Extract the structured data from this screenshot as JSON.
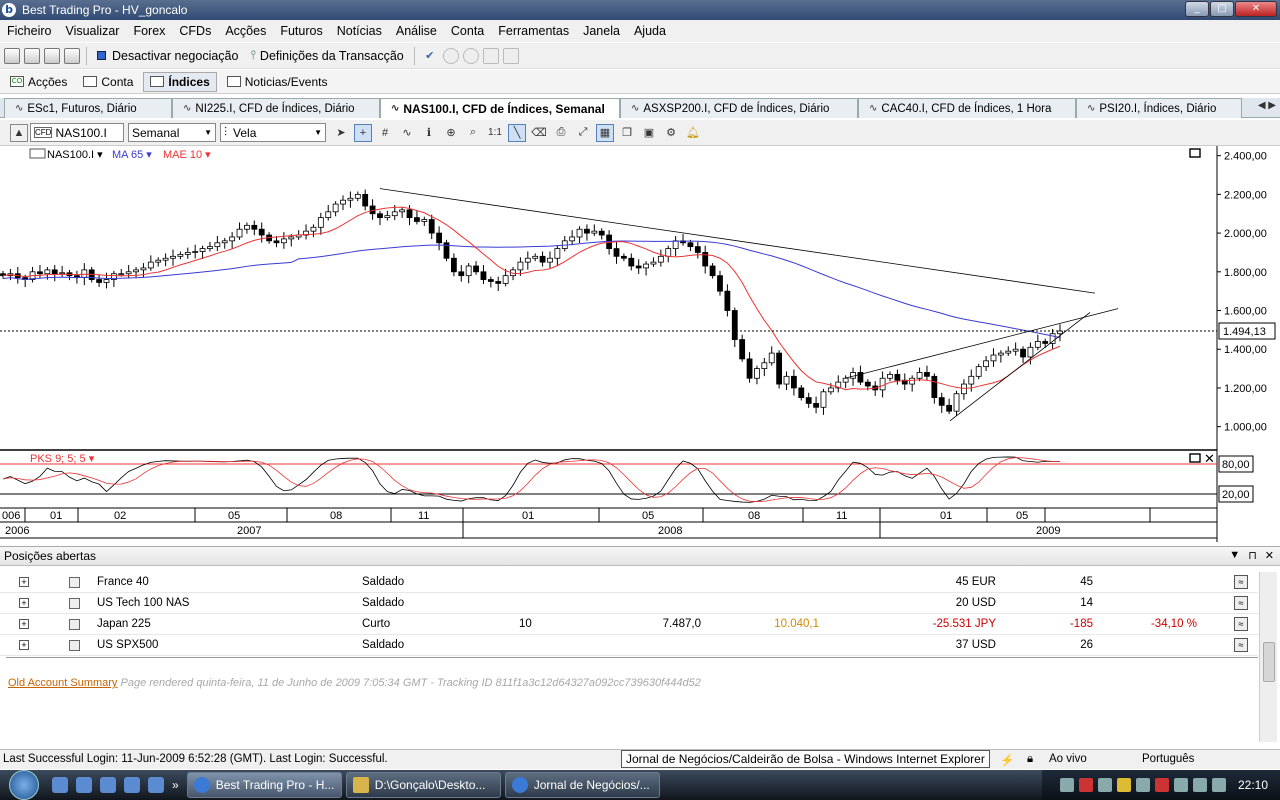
{
  "window": {
    "title": "Best Trading Pro - HV_goncalo"
  },
  "menu": [
    "Ficheiro",
    "Visualizar",
    "Forex",
    "CFDs",
    "Acções",
    "Futuros",
    "Notícias",
    "Análise",
    "Conta",
    "Ferramentas",
    "Janela",
    "Ajuda"
  ],
  "toolbar": {
    "deactivate": "Desactivar negociação",
    "settings": "Definições da Transacção"
  },
  "views": [
    {
      "label": "Acções",
      "active": false
    },
    {
      "label": "Conta",
      "active": false
    },
    {
      "label": "Índices",
      "active": true
    },
    {
      "label": "Noticias/Events",
      "active": false
    }
  ],
  "tabs": [
    "ESc1, Futuros, Diário",
    "NI225.I, CFD de Índices, Diário",
    "NAS100.I, CFD de Índices, Semanal",
    "ASXSP200.I, CFD de Índices, Diário",
    "CAC40.I, CFD de Índices, 1 Hora",
    "PSI20.I, Índices, Diário"
  ],
  "active_tab": 2,
  "chart_toolbar": {
    "symbol": "NAS100.I",
    "period": "Semanal",
    "style": "Vela",
    "zoom": "1:1"
  },
  "legend": {
    "symbol": "NAS100.I",
    "ma": "MA 65",
    "mae": "MAE 10",
    "pks": "PKS 9; 5; 5",
    "cfd_badge": "CFD"
  },
  "chart_data": {
    "type": "candlestick",
    "price_axis_ticks": [
      "2.400,00",
      "2.200,00",
      "2.000,00",
      "1.800,00",
      "1.600,00",
      "1.400,00",
      "1.200,00",
      "1.000,00"
    ],
    "ylim": [
      900,
      2450
    ],
    "current_price": "1.494,13",
    "stoch_ticks": [
      "80,00",
      "20,00"
    ],
    "month_labels": [
      "006",
      "01",
      "02",
      "05",
      "08",
      "11",
      "01",
      "05",
      "08",
      "11",
      "01",
      "05"
    ],
    "year_labels": [
      "2006",
      "2007",
      "2008",
      "2009"
    ],
    "series": [
      {
        "name": "NAS100.I",
        "close": [
          1780,
          1790,
          1770,
          1760,
          1800,
          1790,
          1810,
          1790,
          1795,
          1780,
          1770,
          1810,
          1760,
          1745,
          1760,
          1790,
          1790,
          1800,
          1810,
          1820,
          1850,
          1860,
          1870,
          1880,
          1890,
          1900,
          1905,
          1920,
          1930,
          1950,
          1960,
          1980,
          2020,
          2040,
          2020,
          1990,
          1960,
          1950,
          1970,
          1980,
          1990,
          2010,
          2030,
          2080,
          2110,
          2150,
          2170,
          2180,
          2200,
          2140,
          2100,
          2080,
          2090,
          2110,
          2120,
          2080,
          2060,
          2070,
          2000,
          1950,
          1870,
          1800,
          1780,
          1830,
          1800,
          1760,
          1750,
          1740,
          1780,
          1810,
          1850,
          1870,
          1880,
          1850,
          1870,
          1920,
          1960,
          1980,
          2020,
          2000,
          2010,
          1990,
          1920,
          1880,
          1870,
          1830,
          1820,
          1840,
          1850,
          1880,
          1920,
          1960,
          1950,
          1930,
          1900,
          1830,
          1780,
          1700,
          1600,
          1450,
          1350,
          1250,
          1300,
          1330,
          1380,
          1220,
          1260,
          1200,
          1150,
          1120,
          1100,
          1180,
          1200,
          1230,
          1250,
          1280,
          1230,
          1210,
          1190,
          1250,
          1270,
          1240,
          1220,
          1250,
          1280,
          1260,
          1150,
          1110,
          1080,
          1170,
          1220,
          1260,
          1310,
          1340,
          1370,
          1380,
          1390,
          1400,
          1360,
          1410,
          1440,
          1430,
          1480,
          1494
        ]
      },
      {
        "name": "MA 65"
      },
      {
        "name": "MAE 10"
      }
    ]
  },
  "positions": {
    "title": "Posições abertas",
    "rows": [
      {
        "name": "France 40",
        "status": "Saldado",
        "qty": "",
        "open": "",
        "current": "",
        "pl": "45 EUR",
        "pips": "45",
        "pct": ""
      },
      {
        "name": "US Tech 100 NAS",
        "status": "Saldado",
        "qty": "",
        "open": "",
        "current": "",
        "pl": "20 USD",
        "pips": "14",
        "pct": ""
      },
      {
        "name": "Japan 225",
        "status": "Curto",
        "qty": "10",
        "open": "7.487,0",
        "current": "10.040,1",
        "pl": "-25.531 JPY",
        "pips": "-185",
        "pct": "-34,10 %"
      },
      {
        "name": "US SPX500",
        "status": "Saldado",
        "qty": "",
        "open": "",
        "current": "",
        "pl": "37 USD",
        "pips": "26",
        "pct": ""
      }
    ]
  },
  "footer": {
    "link": "Old Account Summary",
    "text": "Page rendered quinta-feira, 11 de Junho de 2009 7:05:34 GMT - Tracking ID 811f1a3c12d64327a092cc739630f444d52"
  },
  "status": {
    "login": "Last Successful Login: 11-Jun-2009 6:52:28 (GMT). Last Login: Successful.",
    "mode": "Ao vivo",
    "language": "Português"
  },
  "tooltip": "Jornal de Negócios/Caldeirão de Bolsa - Windows Internet Explorer",
  "taskbar": {
    "items": [
      "Best Trading Pro - H...",
      "D:\\Gonçalo\\Deskto...",
      "Jornal de Negócios/..."
    ],
    "clock": "22:10"
  }
}
